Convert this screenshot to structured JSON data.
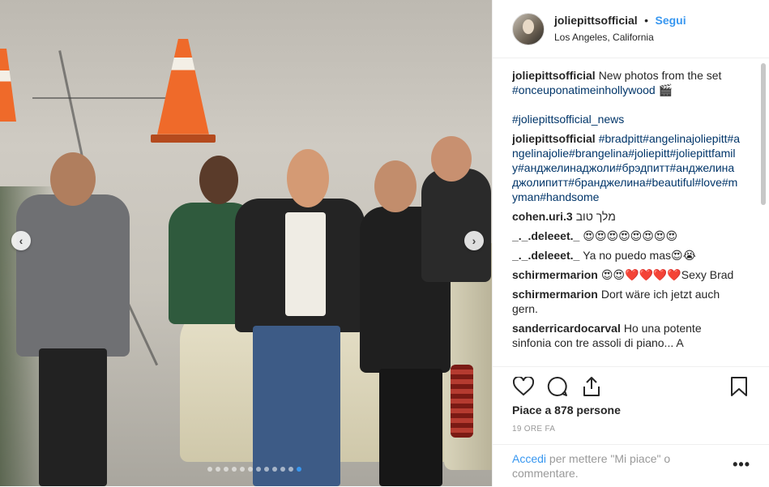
{
  "header": {
    "username": "joliepittsofficial",
    "separator": "•",
    "follow_label": "Segui",
    "location": "Los Angeles, California"
  },
  "caption": {
    "username": "joliepittsofficial",
    "text": "New photos from the set ",
    "hashtag": "#onceuponatimeinhollywood",
    "emoji": " 🎬",
    "hashtag2": "#joliepittsofficial_news"
  },
  "comments": [
    {
      "user": "joliepittsofficial",
      "hashtags": "#bradpitt#angelinajoliepitt#angelinajolie#brangelina#joliepitt#joliepittfamily#анджелинаджоли#брэдпитт#анджелинаджолипитт#бранджелина#beautiful#love#myman#handsome"
    },
    {
      "user": "cohen.uri.3",
      "text": "מלך טוב"
    },
    {
      "user": "_._.deleeet._",
      "text": "😍😍😍😍😍😍😍😍"
    },
    {
      "user": "_._.deleeet._",
      "text": "Ya no puedo mas😍😭"
    },
    {
      "user": "schirmermarion",
      "text": "😍😍❤️❤️❤️❤️Sexy Brad"
    },
    {
      "user": "schirmermarion",
      "text": "Dort wäre ich jetzt auch gern."
    },
    {
      "user": "sanderricardocarval",
      "text": "Ho una potente sinfonia con tre assoli di piano... A"
    }
  ],
  "actions": {
    "like_icon": "heart-icon",
    "comment_icon": "comment-bubble-icon",
    "share_icon": "share-icon",
    "save_icon": "bookmark-icon",
    "likes_text": "Piace a 878 persone",
    "timestamp": "19 ORE FA"
  },
  "login": {
    "link": "Accedi",
    "text": " per mettere \"Mi piace\" o commentare.",
    "more": "•••"
  },
  "carousel": {
    "prev_icon": "chevron-left-icon",
    "next_icon": "chevron-right-icon",
    "prev_glyph": "‹",
    "next_glyph": "›",
    "active_index": 11,
    "count": 12
  },
  "colors": {
    "accent": "#3897f0",
    "hashtag": "#003569",
    "muted": "#999999"
  }
}
